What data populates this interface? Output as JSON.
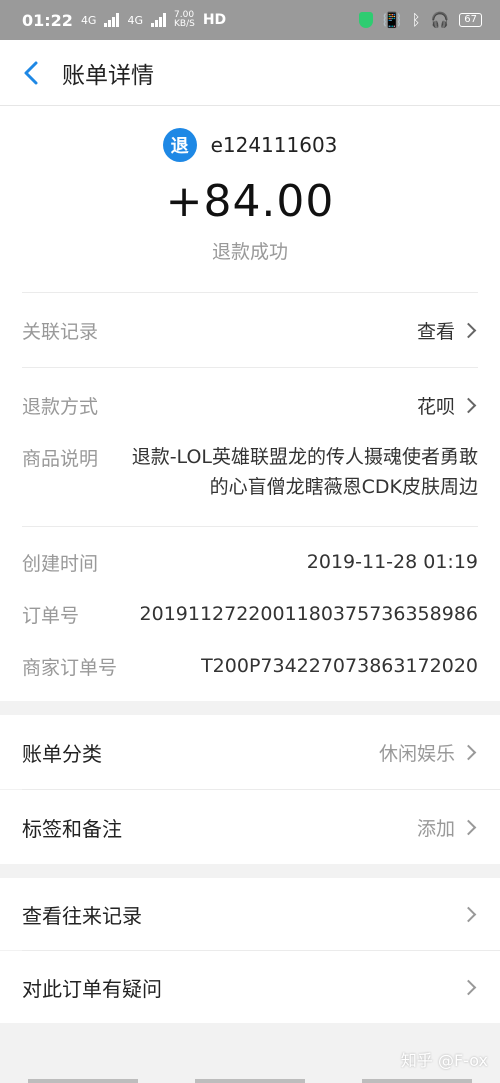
{
  "status_bar": {
    "time": "01:22",
    "net1": "4G",
    "net2": "4G",
    "speed_top": "7.00",
    "speed_bottom": "KB/S",
    "hd": "HD",
    "battery": "67"
  },
  "nav": {
    "title": "账单详情"
  },
  "summary": {
    "badge": "退",
    "merchant": "e124111603",
    "amount": "+84.00",
    "status": "退款成功"
  },
  "details": {
    "related_label": "关联记录",
    "related_value": "查看",
    "refund_method_label": "退款方式",
    "refund_method_value": "花呗",
    "product_label": "商品说明",
    "product_value": "退款-LOL英雄联盟龙的传人摄魂使者勇敢的心盲僧龙瞎薇恩CDK皮肤周边",
    "created_label": "创建时间",
    "created_value": "2019-11-28 01:19",
    "order_label": "订单号",
    "order_value": "2019112722001180375736358986",
    "merchant_order_label": "商家订单号",
    "merchant_order_value": "T200P734227073863172020"
  },
  "options": {
    "category_label": "账单分类",
    "category_value": "休闲娱乐",
    "tags_label": "标签和备注",
    "tags_value": "添加"
  },
  "actions": {
    "history_label": "查看往来记录",
    "question_label": "对此订单有疑问"
  },
  "watermark": "知乎 @F-ox"
}
